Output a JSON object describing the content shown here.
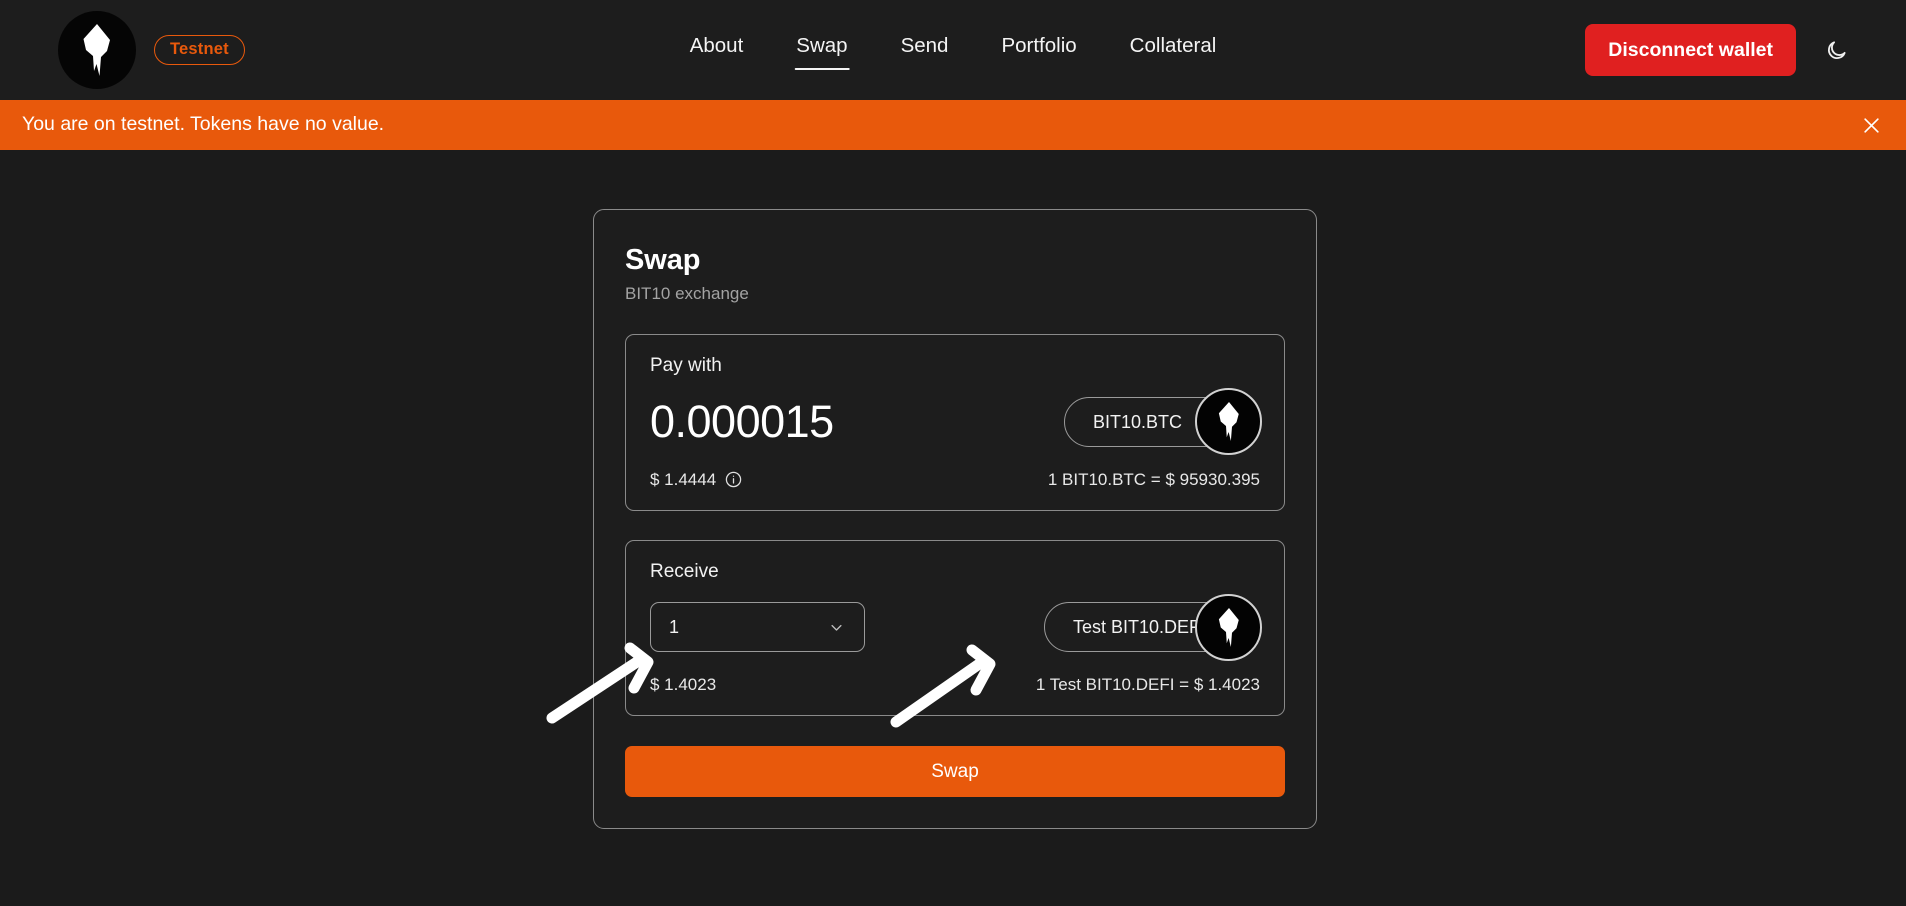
{
  "navbar": {
    "logo_icon": "bit10-iceberg-logo-icon",
    "network_badge": "Testnet",
    "links": [
      {
        "label": "About",
        "active": false
      },
      {
        "label": "Swap",
        "active": true
      },
      {
        "label": "Send",
        "active": false
      },
      {
        "label": "Portfolio",
        "active": false
      },
      {
        "label": "Collateral",
        "active": false
      }
    ],
    "disconnect_label": "Disconnect wallet",
    "theme_toggle_icon": "moon-icon",
    "accent_color": "#e8590c",
    "danger_color": "#e02020"
  },
  "banner": {
    "message": "You are on testnet. Tokens have no value.",
    "background": "#e8590c",
    "close_icon": "close-icon"
  },
  "swap_card": {
    "title": "Swap",
    "subtitle": "BIT10 exchange",
    "pay_with": {
      "label": "Pay with",
      "amount": "0.000015",
      "token": "BIT10.BTC",
      "token_icon": "bit10-iceberg-token-icon",
      "chevron_icon": "chevron-down-icon",
      "usd_value": "$ 1.4444",
      "info_icon": "info-circle-icon",
      "rate": "1 BIT10.BTC = $ 95930.395"
    },
    "receive": {
      "label": "Receive",
      "quantity": "1",
      "quantity_chevron_icon": "chevron-down-icon",
      "token": "Test BIT10.DEFI",
      "token_icon": "bit10-iceberg-token-icon",
      "chevron_icon": "chevron-down-icon",
      "usd_value": "$ 1.4023",
      "rate": "1 Test BIT10.DEFI = $ 1.4023"
    },
    "submit_label": "Swap"
  },
  "annotations": {
    "arrow_left": "white-arrow-pointing-to-receive-quantity",
    "arrow_right": "white-arrow-pointing-to-receive-token"
  }
}
